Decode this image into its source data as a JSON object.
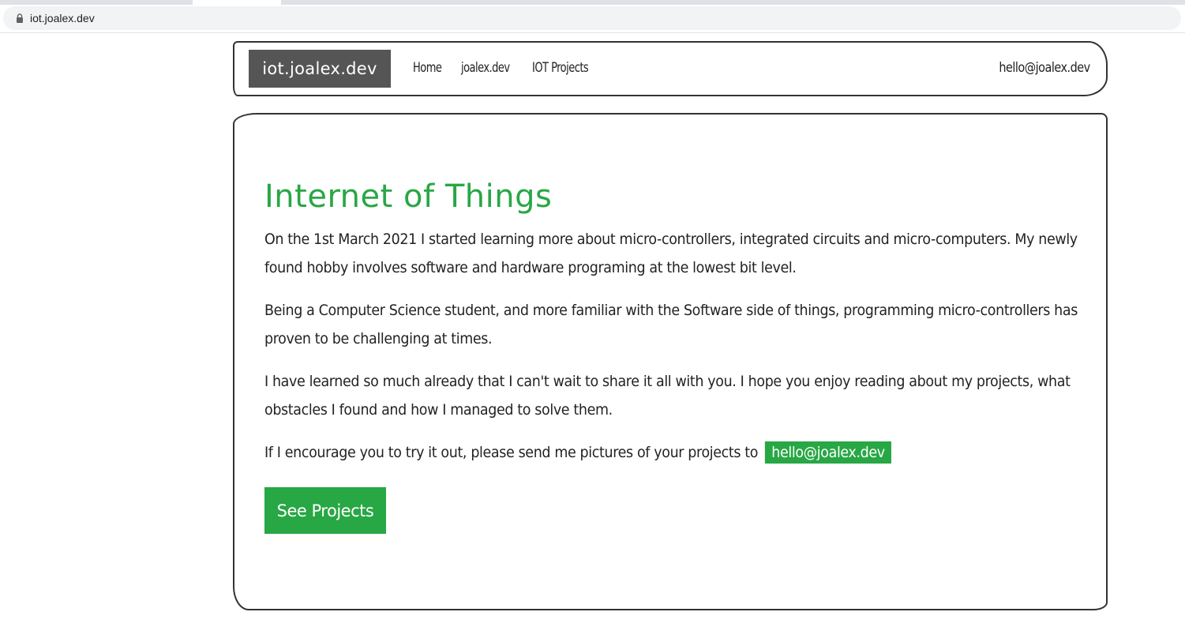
{
  "browser": {
    "url": "iot.joalex.dev"
  },
  "navbar": {
    "brand": "iot.joalex.dev",
    "links": [
      "Home",
      "joalex.dev",
      "IOT Projects"
    ],
    "email": "hello@joalex.dev"
  },
  "hero": {
    "title": "Internet of Things",
    "paragraphs": [
      "On the 1st March 2021 I started learning more about micro-controllers, integrated circuits and micro-computers. My newly found hobby involves software and hardware programing at the lowest bit level.",
      "Being a Computer Science student, and more familiar with the Software side of things, programming micro-controllers has proven to be challenging at times.",
      "I have learned so much already that I can't wait to share it all with you. I hope you enjoy reading about my projects, what obstacles I found and how I managed to solve them."
    ],
    "contact_text": "If I encourage you to try it out, please send me pictures of your projects to",
    "contact_email": "hello@joalex.dev",
    "cta_label": "See Projects"
  },
  "colors": {
    "accent": "#28a745",
    "brand_bg": "#555555"
  },
  "icons": {
    "lock": "lock-icon"
  }
}
